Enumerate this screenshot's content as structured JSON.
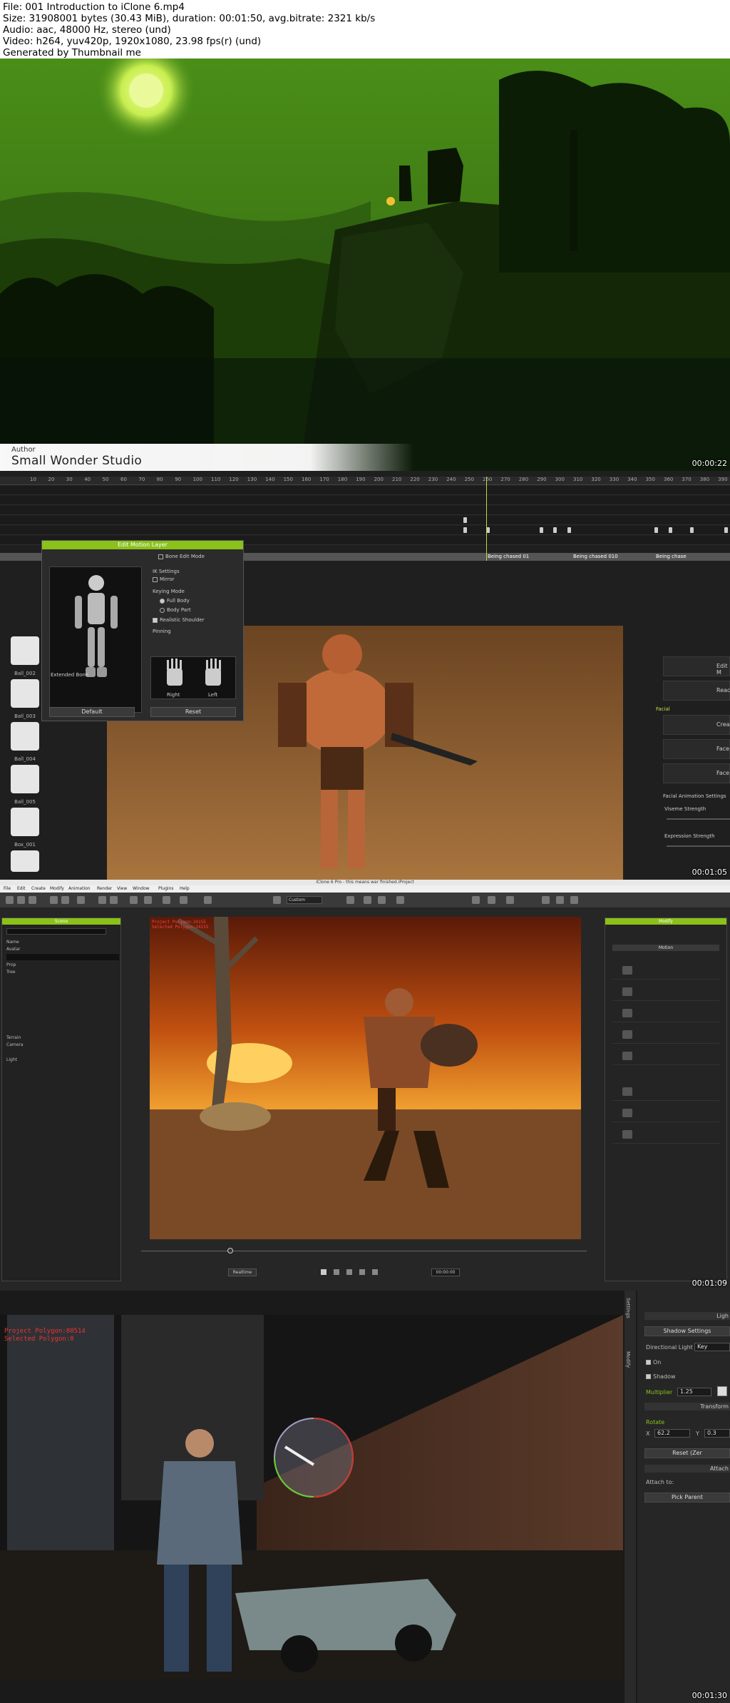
{
  "header": {
    "file": "File: 001 Introduction to iClone 6.mp4",
    "size": "Size: 31908001 bytes (30.43 MiB), duration: 00:01:50, avg.bitrate: 2321 kb/s",
    "audio": "Audio: aac, 48000 Hz, stereo (und)",
    "video": "Video: h264, yuv420p, 1920x1080, 23.98 fps(r) (und)",
    "generated": "Generated by Thumbnail me"
  },
  "frame1": {
    "author_label": "Author",
    "author_name": "Small Wonder Studio",
    "timestamp": "00:00:22"
  },
  "frame2": {
    "timestamp": "00:01:05",
    "ruler_ticks": [
      "10",
      "20",
      "30",
      "40",
      "50",
      "60",
      "70",
      "80",
      "90",
      "100",
      "110",
      "120",
      "130",
      "140",
      "150",
      "160",
      "170",
      "180",
      "190",
      "200",
      "210",
      "220",
      "230",
      "240",
      "250",
      "260",
      "270",
      "280",
      "290",
      "300",
      "310",
      "320",
      "330",
      "340",
      "350",
      "360",
      "370",
      "380",
      "390"
    ],
    "clip_labels": [
      "Being chased 01",
      "Being chased 010",
      "Being chase"
    ],
    "edit_motion_layer": {
      "title": "Edit Motion Layer",
      "bone_edit_mode": "Bone Edit Mode",
      "ik_settings": "IK Settings",
      "mirror": "Mirror",
      "keying_mode": "Keying Mode",
      "full_body": "Full Body",
      "body_part": "Body Part",
      "realistic_shoulder": "Realistic Shoulder",
      "pinning": "Pinning",
      "extended_bone": "Extended Bone",
      "right": "Right",
      "left": "Left",
      "default_btn": "Default",
      "reset_btn": "Reset"
    },
    "library_items": [
      "Ball_002",
      "Ball_003",
      "Ball_004",
      "Ball_005",
      "Box_001"
    ],
    "right_panel": {
      "edit": "Edit M",
      "reach": "Reac",
      "facial": "Facial",
      "create": "Creat",
      "face1": "Face",
      "face2": "Face",
      "facial_anim_settings": "Facial Animation Settings",
      "viseme_strength": "Viseme Strength",
      "expression_strength": "Expression Strength"
    }
  },
  "frame3": {
    "timestamp": "00:01:09",
    "window_title": "iClone 6 Pro - this means war finished.iProject",
    "menu": [
      "File",
      "Edit",
      "Create",
      "Modify",
      "Animation",
      "Render",
      "View",
      "Window",
      "Plugins",
      "Help"
    ],
    "scene_title": "Scene",
    "modify_title": "Modify",
    "modify_tab": "Motion",
    "tree": [
      "Name",
      "Avatar",
      "Prop",
      "Tree",
      "Terrain",
      "Camera",
      "Light"
    ],
    "polygon_text_1": "Project Polygon:24155",
    "polygon_text_2": "Selected Polygon:24155",
    "custom_dropdown": "Custom",
    "realtime": "Realtime",
    "time": "00:00:00"
  },
  "frame4": {
    "timestamp": "00:01:30",
    "project_polygon": "Project Polygon:80514",
    "selected_polygon": "Selected Polygon:0",
    "side_tabs": [
      "Settings",
      "Modify"
    ],
    "light_panel": {
      "light": "Ligh",
      "shadow_settings": "Shadow Settings",
      "directional_light": "Directional Light",
      "key": "Key",
      "on": "On",
      "shadow": "Shadow",
      "multiplier": "Multiplier",
      "multiplier_value": "1.25",
      "transform": "Transform",
      "rotate": "Rotate",
      "x_label": "X",
      "x_value": "62.2",
      "y_label": "Y",
      "y_value": "0.3",
      "reset_zero": "Reset (Zer",
      "attach": "Attach",
      "attach_to": "Attach to:",
      "pick_parent": "Pick Parent"
    }
  }
}
